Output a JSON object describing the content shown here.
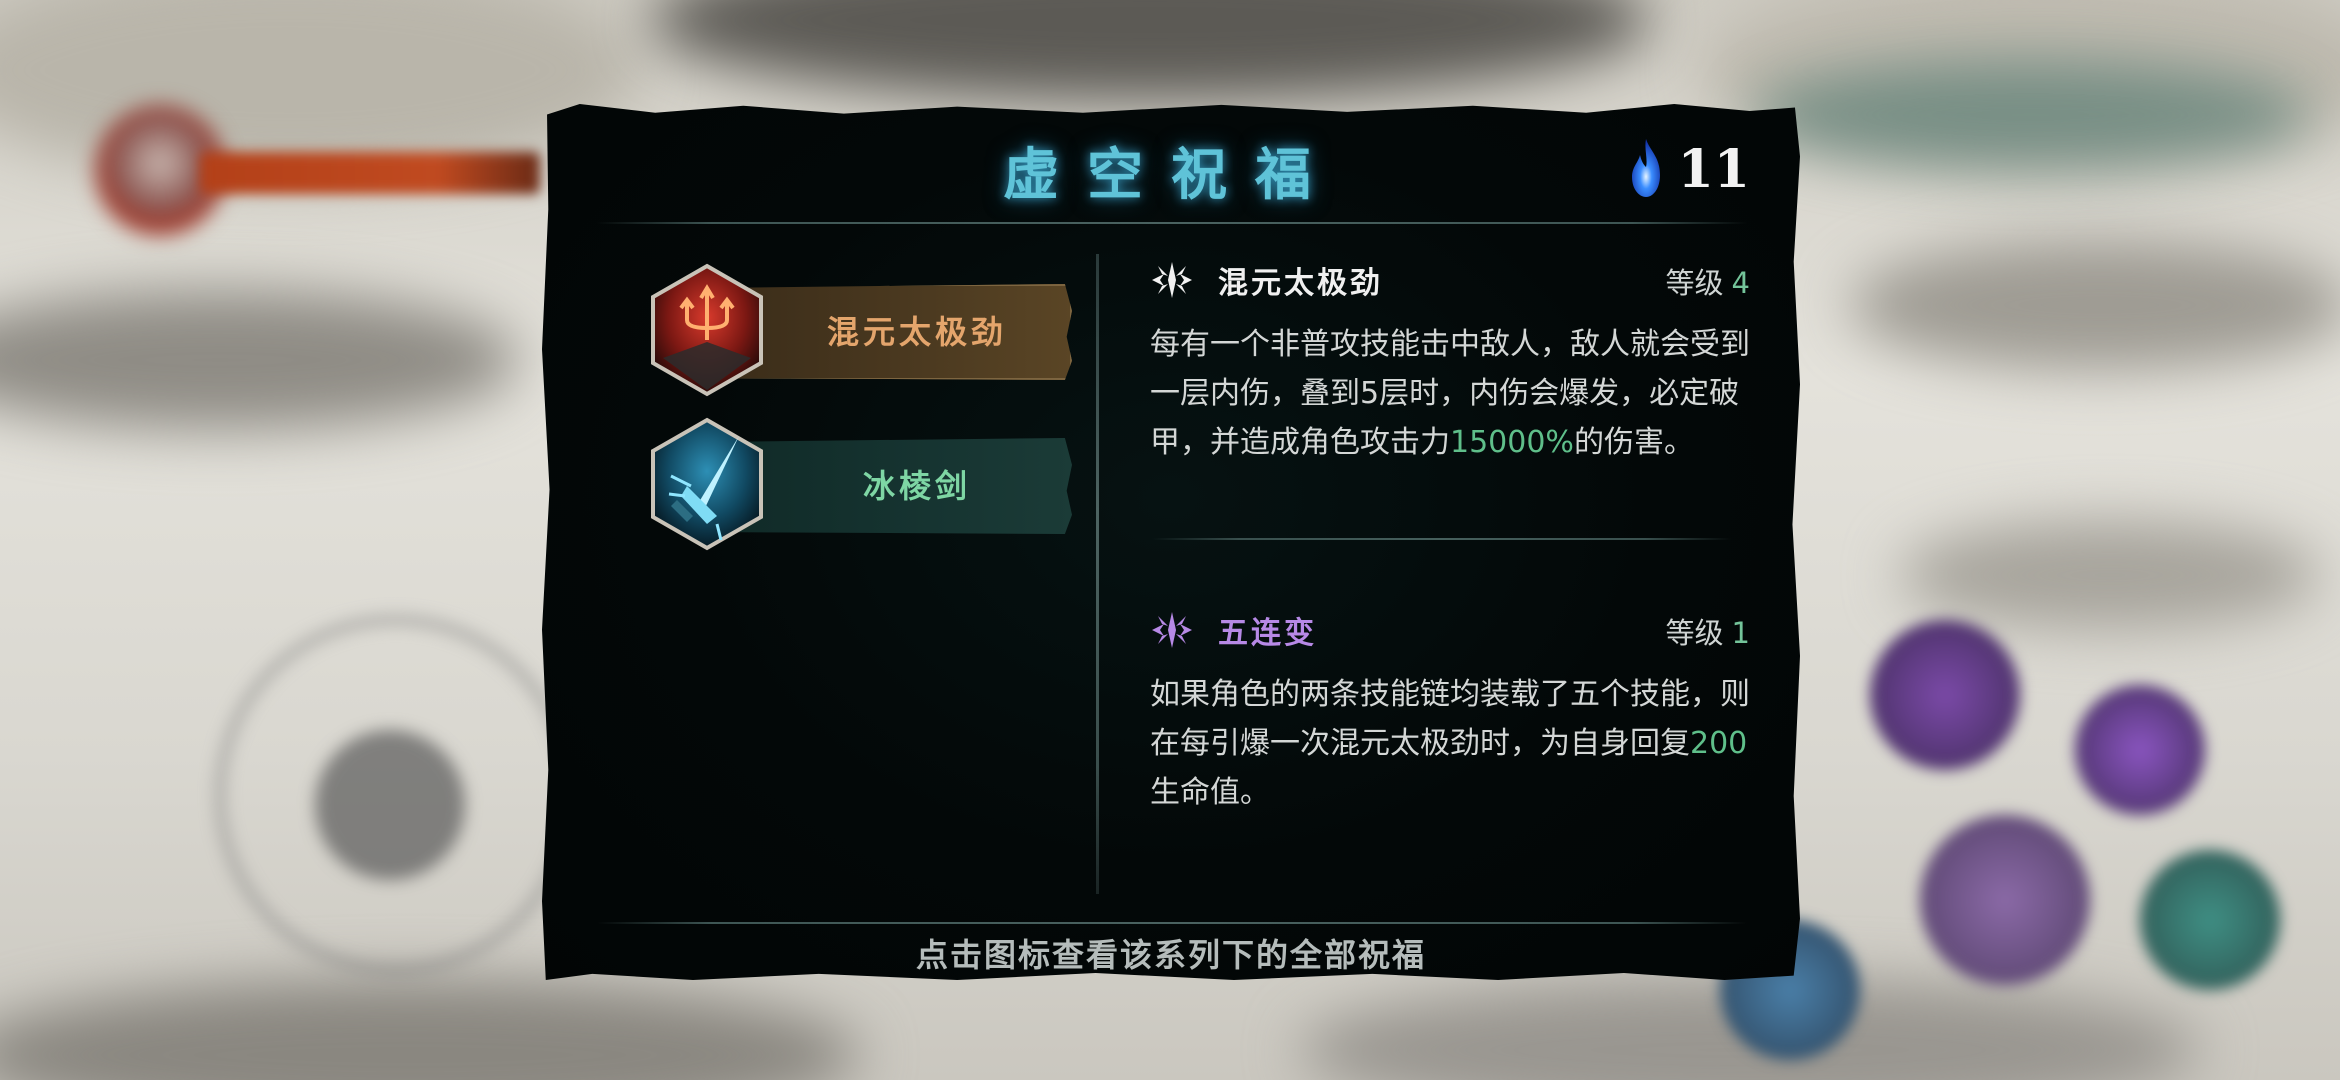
{
  "panel": {
    "title": "虚空祝福",
    "soul_count": "11"
  },
  "blessing_series": [
    {
      "name": "混元太极劲",
      "icon": "trident-red-icon",
      "color": "#e4a56c",
      "selected": true
    },
    {
      "name": "冰棱剑",
      "icon": "ice-sword-icon",
      "color": "#7ed6a4",
      "selected": false
    }
  ],
  "details": [
    {
      "name": "混元太极劲",
      "level_label": "等级",
      "level": "4",
      "desc_parts": [
        {
          "text": "每有一个非普攻技能击中敌人，敌人就会受到一层内伤，叠到5层时，内伤会爆发，必定破甲，并造成角色攻击力",
          "hl": false
        },
        {
          "text": "15000%",
          "hl": true
        },
        {
          "text": "的伤害。",
          "hl": false
        }
      ]
    },
    {
      "name": "五连变",
      "level_label": "等级",
      "level": "1",
      "desc_parts": [
        {
          "text": "如果角色的两条技能链均装载了五个技能，则在每引爆一次混元太极劲时，为自身回复",
          "hl": false
        },
        {
          "text": "200",
          "hl": true
        },
        {
          "text": "生命值。",
          "hl": false
        }
      ]
    }
  ],
  "footer": "点击图标查看该系列下的全部祝福",
  "colors": {
    "title": "#5fc3d8",
    "highlight": "#5fbf8a",
    "level_number": "#74c49a",
    "subblessing_name": "#b789e6"
  }
}
